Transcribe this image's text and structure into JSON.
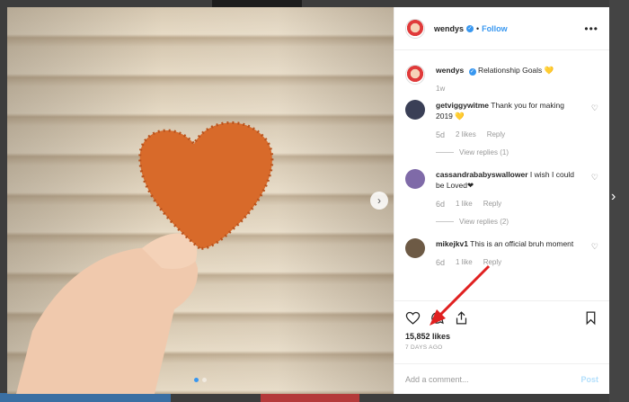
{
  "post": {
    "author": "wendys",
    "follow_label": "Follow",
    "separator": "•",
    "more_icon": "more-horizontal-icon",
    "caption": "Relationship Goals 💛",
    "caption_time": "1w"
  },
  "comments": [
    {
      "username": "getviggywitme",
      "text": "Thank you for making 2019 💛",
      "time": "5d",
      "likes": "2 likes",
      "reply_label": "Reply",
      "view_replies": "View replies (1)",
      "avatar_color": "#3a3f56"
    },
    {
      "username": "cassandrababyswallower",
      "text": "I wish I could be Loved❤",
      "time": "6d",
      "likes": "1 like",
      "reply_label": "Reply",
      "view_replies": "View replies (2)",
      "avatar_color": "#7f6aa8"
    },
    {
      "username": "mikejkv1",
      "text": "This is an official bruh moment",
      "time": "6d",
      "likes": "1 like",
      "reply_label": "Reply",
      "avatar_color": "#6d5a45"
    }
  ],
  "actions": {
    "likes": "15,852 likes",
    "post_time": "7 DAYS AGO",
    "comment_placeholder": "Add a comment...",
    "post_label": "Post"
  },
  "navigation": {
    "next_photo_glyph": "›",
    "next_post_glyph": "›"
  },
  "colors": {
    "accent": "#3897f0",
    "nugget": "#d86a2a",
    "arrow": "#e02020"
  }
}
